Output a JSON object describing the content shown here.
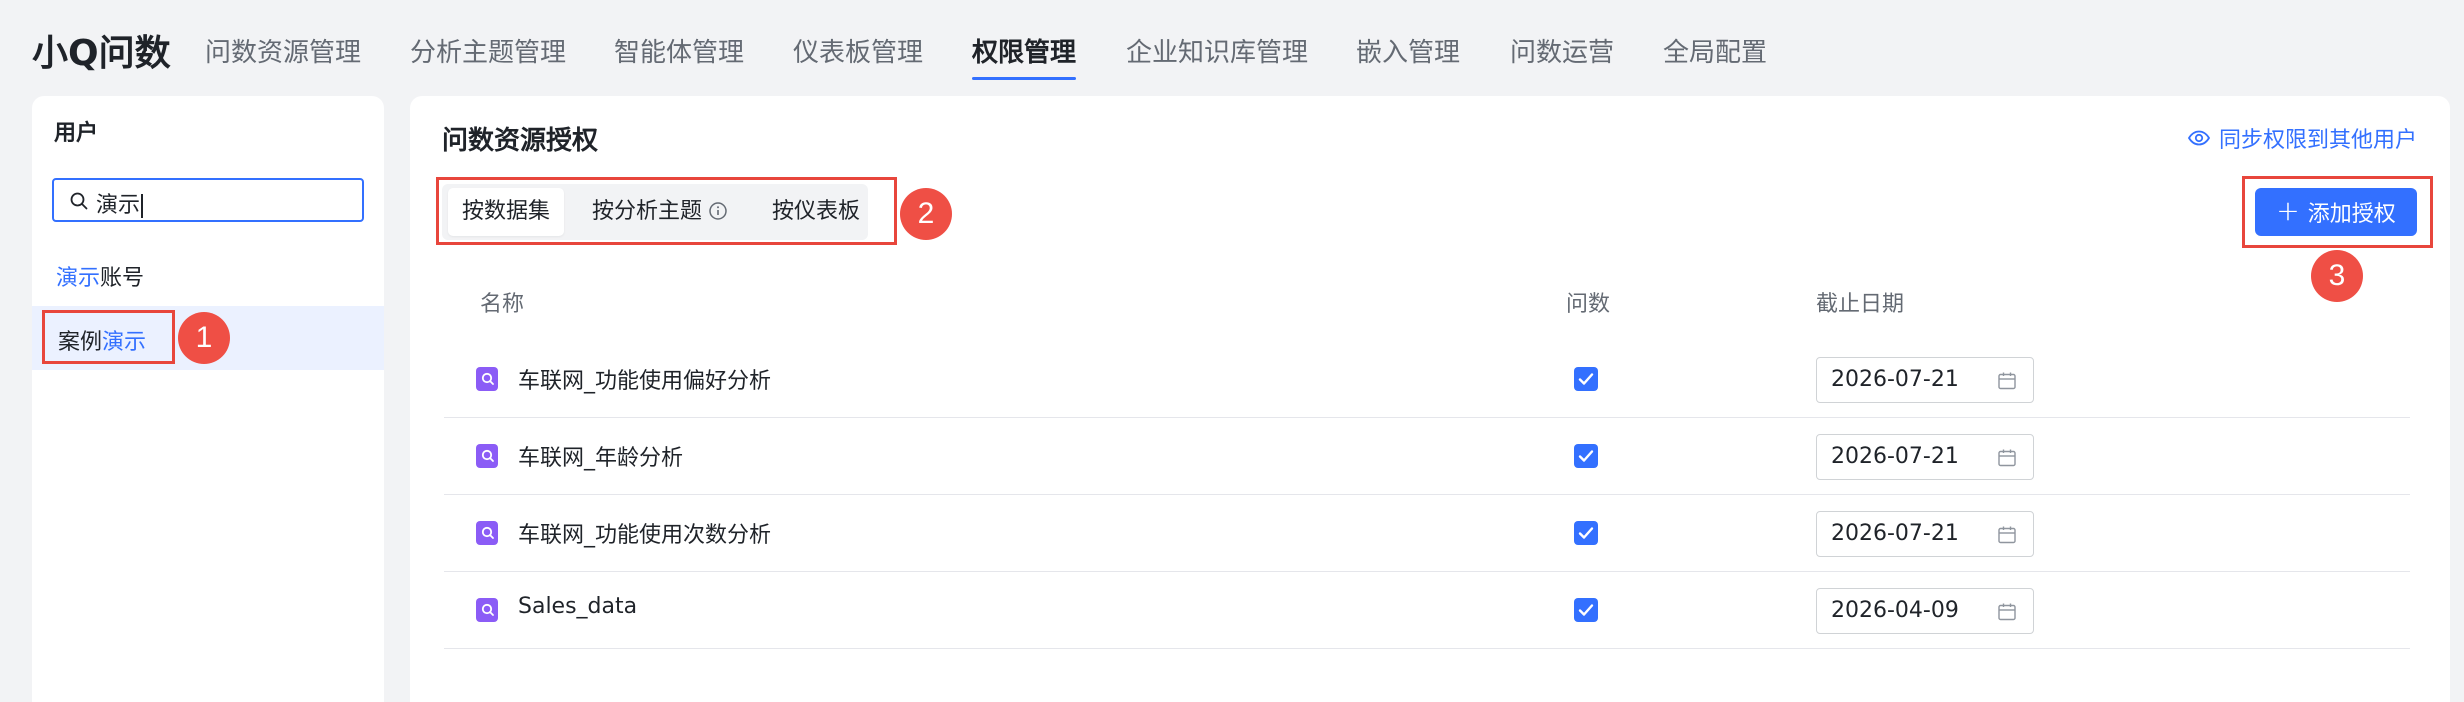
{
  "app": {
    "title": "小Q问数"
  },
  "nav": {
    "items": [
      {
        "label": "问数资源管理"
      },
      {
        "label": "分析主题管理"
      },
      {
        "label": "智能体管理"
      },
      {
        "label": "仪表板管理"
      },
      {
        "label": "权限管理",
        "active": true
      },
      {
        "label": "企业知识库管理"
      },
      {
        "label": "嵌入管理"
      },
      {
        "label": "问数运营"
      },
      {
        "label": "全局配置"
      }
    ]
  },
  "users_panel": {
    "title": "用户",
    "search": {
      "value": "演示"
    },
    "users": [
      {
        "highlight": "演示",
        "rest": "账号",
        "selected": false
      },
      {
        "prefix": "案例",
        "highlight": "演示",
        "selected": true
      }
    ]
  },
  "main": {
    "title": "问数资源授权",
    "sync_link": "同步权限到其他用户",
    "tabs": [
      {
        "label": "按数据集",
        "active": true
      },
      {
        "label": "按分析主题",
        "has_info_icon": true
      },
      {
        "label": "按仪表板"
      }
    ],
    "add_button": "添加授权",
    "table": {
      "columns": [
        "名称",
        "问数",
        "截止日期"
      ],
      "rows": [
        {
          "name": "车联网_功能使用偏好分析",
          "checked": true,
          "date": "2026-07-21"
        },
        {
          "name": "车联网_年龄分析",
          "checked": true,
          "date": "2026-07-21"
        },
        {
          "name": "车联网_功能使用次数分析",
          "checked": true,
          "date": "2026-07-21"
        },
        {
          "name": "Sales_data",
          "checked": true,
          "date": "2026-04-09"
        }
      ]
    }
  },
  "annotations": [
    "1",
    "2",
    "3"
  ],
  "colors": {
    "accent": "#3370ff",
    "annotation": "#e8463c",
    "file_icon": "#8b5cf6"
  }
}
